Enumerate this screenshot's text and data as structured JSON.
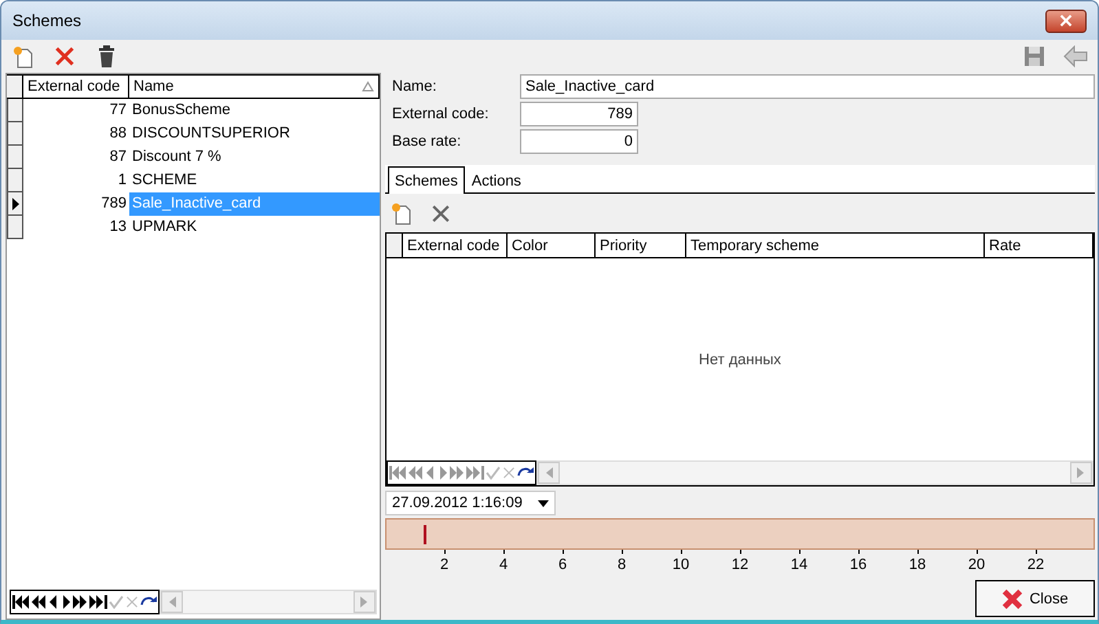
{
  "window": {
    "title": "Schemes"
  },
  "list": {
    "columns": [
      {
        "label": "External code"
      },
      {
        "label": "Name",
        "sorted": true
      }
    ],
    "rows": [
      {
        "code": "77",
        "name": "BonusScheme",
        "selected": false
      },
      {
        "code": "88",
        "name": "DISCOUNTSUPERIOR",
        "selected": false
      },
      {
        "code": "87",
        "name": "Discount 7 %",
        "selected": false
      },
      {
        "code": "1",
        "name": "SCHEME",
        "selected": false
      },
      {
        "code": "789",
        "name": "Sale_Inactive_card",
        "selected": true
      },
      {
        "code": "13",
        "name": "UPMARK",
        "selected": false
      }
    ]
  },
  "form": {
    "fields": [
      {
        "label": "Name:",
        "value": "Sale_Inactive_card"
      },
      {
        "label": "External code:",
        "value": "789"
      },
      {
        "label": "Base rate:",
        "value": "0"
      }
    ]
  },
  "tabs": [
    {
      "label": "Schemes",
      "selected": true
    },
    {
      "label": "Actions",
      "selected": false
    }
  ],
  "detail_grid": {
    "columns": [
      "External code",
      "Color",
      "Priority",
      "Temporary scheme",
      "Rate"
    ],
    "empty_text": "Нет данных"
  },
  "timeline": {
    "date": "27.09.2012 1:16:09",
    "level": 0.052,
    "ticks": [
      "2",
      "4",
      "6",
      "8",
      "10",
      "12",
      "14",
      "16",
      "18",
      "20",
      "22"
    ]
  },
  "close_button": "Close"
}
